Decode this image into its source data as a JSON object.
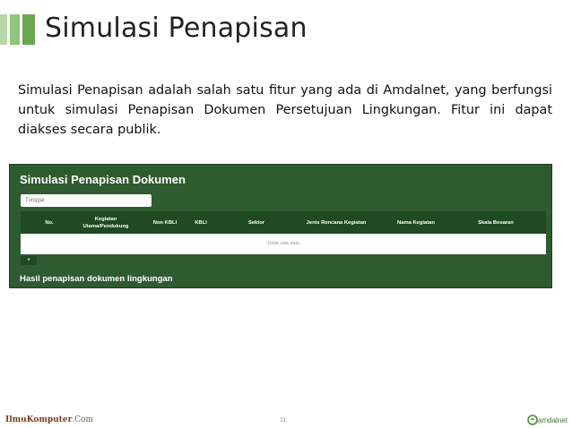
{
  "slide": {
    "title": "Simulasi Penapisan",
    "description": "Simulasi Penapisan adalah salah satu fitur yang ada di Amdalnet, yang berfungsi untuk simulasi Penapisan Dokumen Persetujuan Lingkungan. Fitur ini dapat diakses secara publik.",
    "accent_colors": [
      "#b7d7a8",
      "#93c47d",
      "#6aa84f"
    ]
  },
  "panel": {
    "title": "Simulasi Penapisan Dokumen",
    "select_value": "Tunggal",
    "columns": [
      "No.",
      "Kegiatan Utama/Pendukung",
      "Non KBLI",
      "KBLI",
      "Sektor",
      "Jenis Rencana Kegiatan",
      "Nama Kegiatan",
      "Skala Besaran"
    ],
    "empty_text": "Tidak ada data",
    "add_label": "+",
    "result_title": "Hasil penapisan dokumen lingkungan",
    "bg_color": "#2e5b30"
  },
  "footer": {
    "brand_main": "IlmuKomputer",
    "brand_sub": ".Com",
    "page_number": "11",
    "logo_text": "amdalnet"
  }
}
